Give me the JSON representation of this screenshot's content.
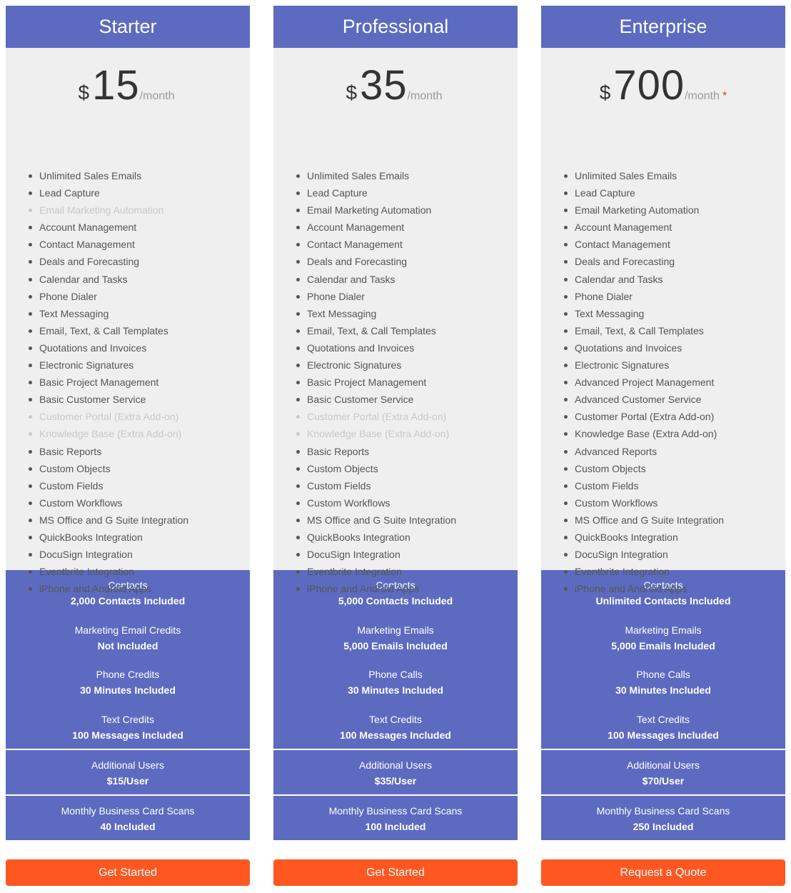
{
  "colors": {
    "header": "#5c6bc0",
    "body": "#efefef",
    "cta": "#ff5722",
    "asterisk": "#e53935"
  },
  "plans": [
    {
      "name": "Starter",
      "currency": "$",
      "amount": "15",
      "period": "/month",
      "asterisk": "",
      "features": [
        {
          "label": "Unlimited Sales Emails",
          "included": true
        },
        {
          "label": "Lead Capture",
          "included": true
        },
        {
          "label": "Email Marketing Automation",
          "included": false
        },
        {
          "label": "Account Management",
          "included": true
        },
        {
          "label": "Contact Management",
          "included": true
        },
        {
          "label": "Deals and Forecasting",
          "included": true
        },
        {
          "label": "Calendar and Tasks",
          "included": true
        },
        {
          "label": "Phone Dialer",
          "included": true
        },
        {
          "label": "Text Messaging",
          "included": true
        },
        {
          "label": "Email, Text, & Call Templates",
          "included": true
        },
        {
          "label": "Quotations and Invoices",
          "included": true
        },
        {
          "label": "Electronic Signatures",
          "included": true
        },
        {
          "label": "Basic Project Management",
          "included": true
        },
        {
          "label": "Basic Customer Service",
          "included": true
        },
        {
          "label": "Customer Portal (Extra Add-on)",
          "included": false
        },
        {
          "label": "Knowledge Base (Extra Add-on)",
          "included": false
        },
        {
          "label": "Basic Reports",
          "included": true
        },
        {
          "label": "Custom Objects",
          "included": true
        },
        {
          "label": "Custom Fields",
          "included": true
        },
        {
          "label": "Custom Workflows",
          "included": true
        },
        {
          "label": "MS Office and G Suite Integration",
          "included": true
        },
        {
          "label": "QuickBooks Integration",
          "included": true
        },
        {
          "label": "DocuSign Integration",
          "included": true
        },
        {
          "label": "Eventbrite Integration",
          "included": true
        },
        {
          "label": "iPhone and Android Apps",
          "included": true
        }
      ],
      "credits": [
        {
          "label": "Contacts",
          "value": "2,000 Contacts Included"
        },
        {
          "label": "Marketing Email Credits",
          "value": "Not Included"
        },
        {
          "label": "Phone Credits",
          "value": "30 Minutes Included"
        },
        {
          "label": "Text Credits",
          "value": "100 Messages Included"
        }
      ],
      "additional_users": {
        "label": "Additional Users",
        "value": "$15/User"
      },
      "card_scans": {
        "label": "Monthly Business Card Scans",
        "value": "40 Included"
      },
      "cta": "Get Started"
    },
    {
      "name": "Professional",
      "currency": "$",
      "amount": "35",
      "period": "/month",
      "asterisk": "",
      "features": [
        {
          "label": "Unlimited Sales Emails",
          "included": true
        },
        {
          "label": "Lead Capture",
          "included": true
        },
        {
          "label": "Email Marketing Automation",
          "included": true
        },
        {
          "label": "Account Management",
          "included": true
        },
        {
          "label": "Contact Management",
          "included": true
        },
        {
          "label": "Deals and Forecasting",
          "included": true
        },
        {
          "label": "Calendar and Tasks",
          "included": true
        },
        {
          "label": "Phone Dialer",
          "included": true
        },
        {
          "label": "Text Messaging",
          "included": true
        },
        {
          "label": "Email, Text, & Call Templates",
          "included": true
        },
        {
          "label": "Quotations and Invoices",
          "included": true
        },
        {
          "label": "Electronic Signatures",
          "included": true
        },
        {
          "label": "Basic Project Management",
          "included": true
        },
        {
          "label": "Basic Customer Service",
          "included": true
        },
        {
          "label": "Customer Portal (Extra Add-on)",
          "included": false
        },
        {
          "label": "Knowledge Base (Extra Add-on)",
          "included": false
        },
        {
          "label": "Basic Reports",
          "included": true
        },
        {
          "label": "Custom Objects",
          "included": true
        },
        {
          "label": "Custom Fields",
          "included": true
        },
        {
          "label": "Custom Workflows",
          "included": true
        },
        {
          "label": "MS Office and G Suite Integration",
          "included": true
        },
        {
          "label": "QuickBooks Integration",
          "included": true
        },
        {
          "label": "DocuSign Integration",
          "included": true
        },
        {
          "label": "Eventbrite Integration",
          "included": true
        },
        {
          "label": "iPhone and Android Apps",
          "included": true
        }
      ],
      "credits": [
        {
          "label": "Contacts",
          "value": "5,000 Contacts Included"
        },
        {
          "label": "Marketing Emails",
          "value": "5,000 Emails Included"
        },
        {
          "label": "Phone Calls",
          "value": "30 Minutes Included"
        },
        {
          "label": "Text Credits",
          "value": "100 Messages Included"
        }
      ],
      "additional_users": {
        "label": "Additional Users",
        "value": "$35/User"
      },
      "card_scans": {
        "label": "Monthly Business Card Scans",
        "value": "100 Included"
      },
      "cta": "Get Started"
    },
    {
      "name": "Enterprise",
      "currency": "$",
      "amount": "700",
      "period": "/month",
      "asterisk": "*",
      "features": [
        {
          "label": "Unlimited Sales Emails",
          "included": true
        },
        {
          "label": "Lead Capture",
          "included": true
        },
        {
          "label": "Email Marketing Automation",
          "included": true
        },
        {
          "label": "Account Management",
          "included": true
        },
        {
          "label": "Contact Management",
          "included": true
        },
        {
          "label": "Deals and Forecasting",
          "included": true
        },
        {
          "label": "Calendar and Tasks",
          "included": true
        },
        {
          "label": "Phone Dialer",
          "included": true
        },
        {
          "label": "Text Messaging",
          "included": true
        },
        {
          "label": "Email, Text, & Call Templates",
          "included": true
        },
        {
          "label": "Quotations and Invoices",
          "included": true
        },
        {
          "label": "Electronic Signatures",
          "included": true
        },
        {
          "label": "Advanced Project Management",
          "included": true
        },
        {
          "label": "Advanced Customer Service",
          "included": true
        },
        {
          "label": "Customer Portal (Extra Add-on)",
          "included": true
        },
        {
          "label": "Knowledge Base (Extra Add-on)",
          "included": true
        },
        {
          "label": "Advanced Reports",
          "included": true
        },
        {
          "label": "Custom Objects",
          "included": true
        },
        {
          "label": "Custom Fields",
          "included": true
        },
        {
          "label": "Custom Workflows",
          "included": true
        },
        {
          "label": "MS Office and G Suite Integration",
          "included": true
        },
        {
          "label": "QuickBooks Integration",
          "included": true
        },
        {
          "label": "DocuSign Integration",
          "included": true
        },
        {
          "label": "Eventbrite Integration",
          "included": true
        },
        {
          "label": "iPhone and Android Apps",
          "included": true
        }
      ],
      "credits": [
        {
          "label": "Contacts",
          "value": "Unlimited Contacts Included"
        },
        {
          "label": "Marketing Emails",
          "value": "5,000 Emails Included"
        },
        {
          "label": "Phone Calls",
          "value": "30 Minutes Included"
        },
        {
          "label": "Text Credits",
          "value": "100 Messages Included"
        }
      ],
      "additional_users": {
        "label": "Additional Users",
        "value": "$70/User"
      },
      "card_scans": {
        "label": "Monthly Business Card Scans",
        "value": "250 Included"
      },
      "cta": "Request a Quote"
    }
  ]
}
